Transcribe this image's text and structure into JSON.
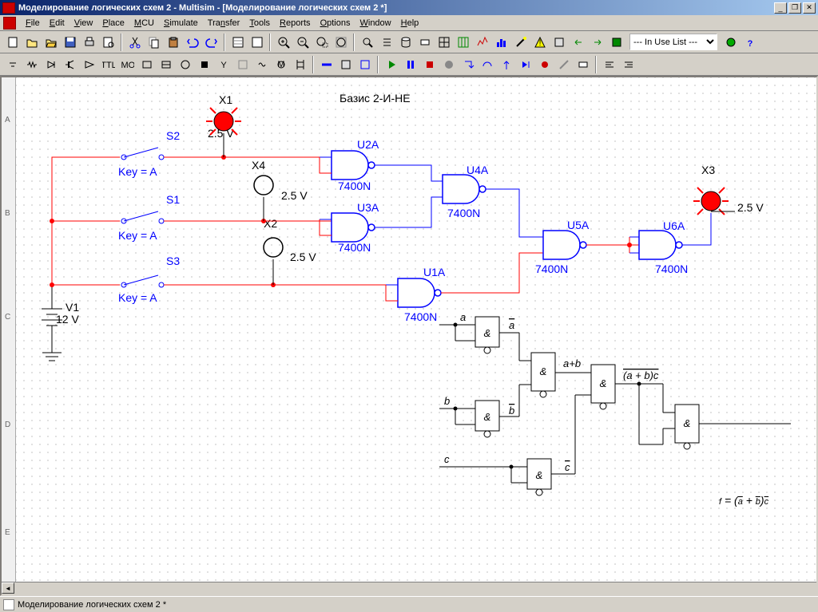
{
  "window": {
    "title": "Моделирование логических схем 2 - Multisim - [Моделирование логических схем 2 *]"
  },
  "menu": {
    "file": "File",
    "edit": "Edit",
    "view": "View",
    "place": "Place",
    "mcu": "MCU",
    "simulate": "Simulate",
    "transfer": "Transfer",
    "tools": "Tools",
    "reports": "Reports",
    "options": "Options",
    "window": "Window",
    "help": "Help"
  },
  "toolbar": {
    "inUseList": "--- In Use List ---"
  },
  "ruler": {
    "a": "A",
    "b": "B",
    "c": "C",
    "d": "D",
    "e": "E"
  },
  "schematic": {
    "title": "Базис 2-И-НЕ",
    "x1": "X1",
    "x2": "X2",
    "x3": "X3",
    "x4": "X4",
    "s1": "S1",
    "s2": "S2",
    "s3": "S3",
    "keyA": "Key = A",
    "v1": "V1",
    "v1val": "12 V",
    "v25": "2.5 V",
    "u1a": "U1A",
    "u2a": "U2A",
    "u3a": "U3A",
    "u4a": "U4A",
    "u5a": "U5A",
    "u6a": "U6A",
    "ic": "7400N"
  },
  "diagram": {
    "amp": "&",
    "a": "a",
    "b": "b",
    "c": "c",
    "a_bar": "a",
    "b_bar": "b",
    "c_bar": "c",
    "apb": "a+b",
    "apbc": "(a + b)c",
    "f": "f = (a + b)c"
  },
  "status": {
    "tab": "Моделирование логических схем 2 *"
  }
}
